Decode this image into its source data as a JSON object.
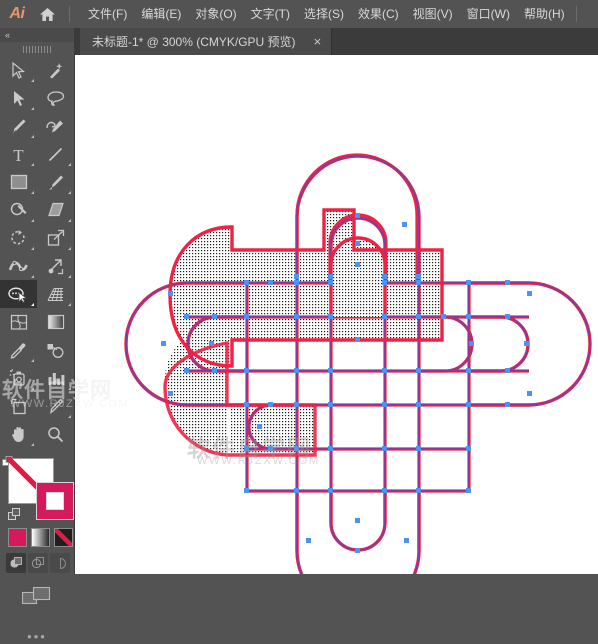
{
  "app": {
    "name": "Ai",
    "logo_color": "#E8956B",
    "home_icon": "home-icon"
  },
  "menubar": {
    "items": [
      {
        "label": "文件(F)",
        "name": "menu-file"
      },
      {
        "label": "编辑(E)",
        "name": "menu-edit"
      },
      {
        "label": "对象(O)",
        "name": "menu-object"
      },
      {
        "label": "文字(T)",
        "name": "menu-type"
      },
      {
        "label": "选择(S)",
        "name": "menu-select"
      },
      {
        "label": "效果(C)",
        "name": "menu-effect"
      },
      {
        "label": "视图(V)",
        "name": "menu-view"
      },
      {
        "label": "窗口(W)",
        "name": "menu-window"
      },
      {
        "label": "帮助(H)",
        "name": "menu-help"
      }
    ]
  },
  "tabbar": {
    "tab_title": "未标题-1* @ 300% (CMYK/GPU 预览)",
    "close_label": "×"
  },
  "toolbar": {
    "collapse_label": "«",
    "more_label": "•••",
    "tools": [
      {
        "name": "selection-tool-icon",
        "label": "选择工具",
        "selected": false,
        "corner": true
      },
      {
        "name": "magic-wand-tool-icon",
        "label": "魔棒工具",
        "selected": false,
        "corner": false
      },
      {
        "name": "direct-selection-tool-icon",
        "label": "直接选择工具",
        "selected": false,
        "corner": true
      },
      {
        "name": "lasso-tool-icon",
        "label": "套索工具",
        "selected": false,
        "corner": false
      },
      {
        "name": "pen-tool-icon",
        "label": "钢笔工具",
        "selected": false,
        "corner": true
      },
      {
        "name": "curvature-tool-icon",
        "label": "曲率工具",
        "selected": false,
        "corner": false
      },
      {
        "name": "type-tool-icon",
        "label": "文字工具",
        "selected": false,
        "corner": true
      },
      {
        "name": "line-segment-tool-icon",
        "label": "直线段工具",
        "selected": false,
        "corner": true
      },
      {
        "name": "rectangle-tool-icon",
        "label": "矩形工具",
        "selected": false,
        "corner": true
      },
      {
        "name": "paintbrush-tool-icon",
        "label": "画笔工具",
        "selected": false,
        "corner": true
      },
      {
        "name": "shaper-tool-icon",
        "label": "Shaper 工具",
        "selected": false,
        "corner": true
      },
      {
        "name": "eraser-tool-icon",
        "label": "橡皮擦工具",
        "selected": false,
        "corner": true
      },
      {
        "name": "rotate-tool-icon",
        "label": "旋转工具",
        "selected": false,
        "corner": true
      },
      {
        "name": "scale-tool-icon",
        "label": "比例缩放工具",
        "selected": false,
        "corner": true
      },
      {
        "name": "width-tool-icon",
        "label": "宽度工具",
        "selected": false,
        "corner": true
      },
      {
        "name": "free-transform-tool-icon",
        "label": "自由变换工具",
        "selected": false,
        "corner": true
      },
      {
        "name": "shape-builder-tool-icon",
        "label": "形状生成器工具",
        "selected": true,
        "corner": true
      },
      {
        "name": "perspective-grid-tool-icon",
        "label": "透视网格工具",
        "selected": false,
        "corner": true
      },
      {
        "name": "mesh-tool-icon",
        "label": "网格工具",
        "selected": false,
        "corner": false
      },
      {
        "name": "gradient-tool-icon",
        "label": "渐变工具",
        "selected": false,
        "corner": false
      },
      {
        "name": "eyedropper-tool-icon",
        "label": "吸管工具",
        "selected": false,
        "corner": true
      },
      {
        "name": "blend-tool-icon",
        "label": "混合工具",
        "selected": false,
        "corner": false
      },
      {
        "name": "symbol-sprayer-tool-icon",
        "label": "符号喷枪工具",
        "selected": false,
        "corner": true
      },
      {
        "name": "column-graph-tool-icon",
        "label": "柱形图工具",
        "selected": false,
        "corner": true
      },
      {
        "name": "artboard-tool-icon",
        "label": "画板工具",
        "selected": false,
        "corner": false
      },
      {
        "name": "slice-tool-icon",
        "label": "切片工具",
        "selected": false,
        "corner": true
      },
      {
        "name": "hand-tool-icon",
        "label": "抓手工具",
        "selected": false,
        "corner": true
      },
      {
        "name": "zoom-tool-icon",
        "label": "缩放工具",
        "selected": false,
        "corner": false
      }
    ],
    "colors": {
      "fill": "#FFFFFF",
      "fill_state": "none",
      "stroke": "#D41A5C",
      "none_slash": "#E01B45"
    },
    "fill_modes": [
      {
        "name": "fill-mode-color",
        "label": "颜色"
      },
      {
        "name": "fill-mode-gradient",
        "label": "渐变"
      },
      {
        "name": "fill-mode-none",
        "label": "无"
      }
    ],
    "screen_modes": [
      {
        "name": "screen-mode-normal",
        "label": "正常屏幕模式",
        "active": true
      },
      {
        "name": "screen-mode-fullmenu",
        "label": "带菜单全屏模式",
        "active": false
      },
      {
        "name": "screen-mode-full",
        "label": "全屏模式",
        "active": false
      }
    ],
    "panel_icon": "arrange-panels-icon"
  },
  "canvas": {
    "background": "#FFFFFF",
    "zoom": "300%",
    "artwork": {
      "name": "celtic-knot-path",
      "stroke_color": "#7B3FA0",
      "selection_color": "#EE2244",
      "anchor_color": "#4D94F0",
      "fill_pattern": "dot-stipple"
    }
  },
  "watermark": {
    "cn": "软件自学网",
    "url": "WWW.RJZXW.COM"
  }
}
